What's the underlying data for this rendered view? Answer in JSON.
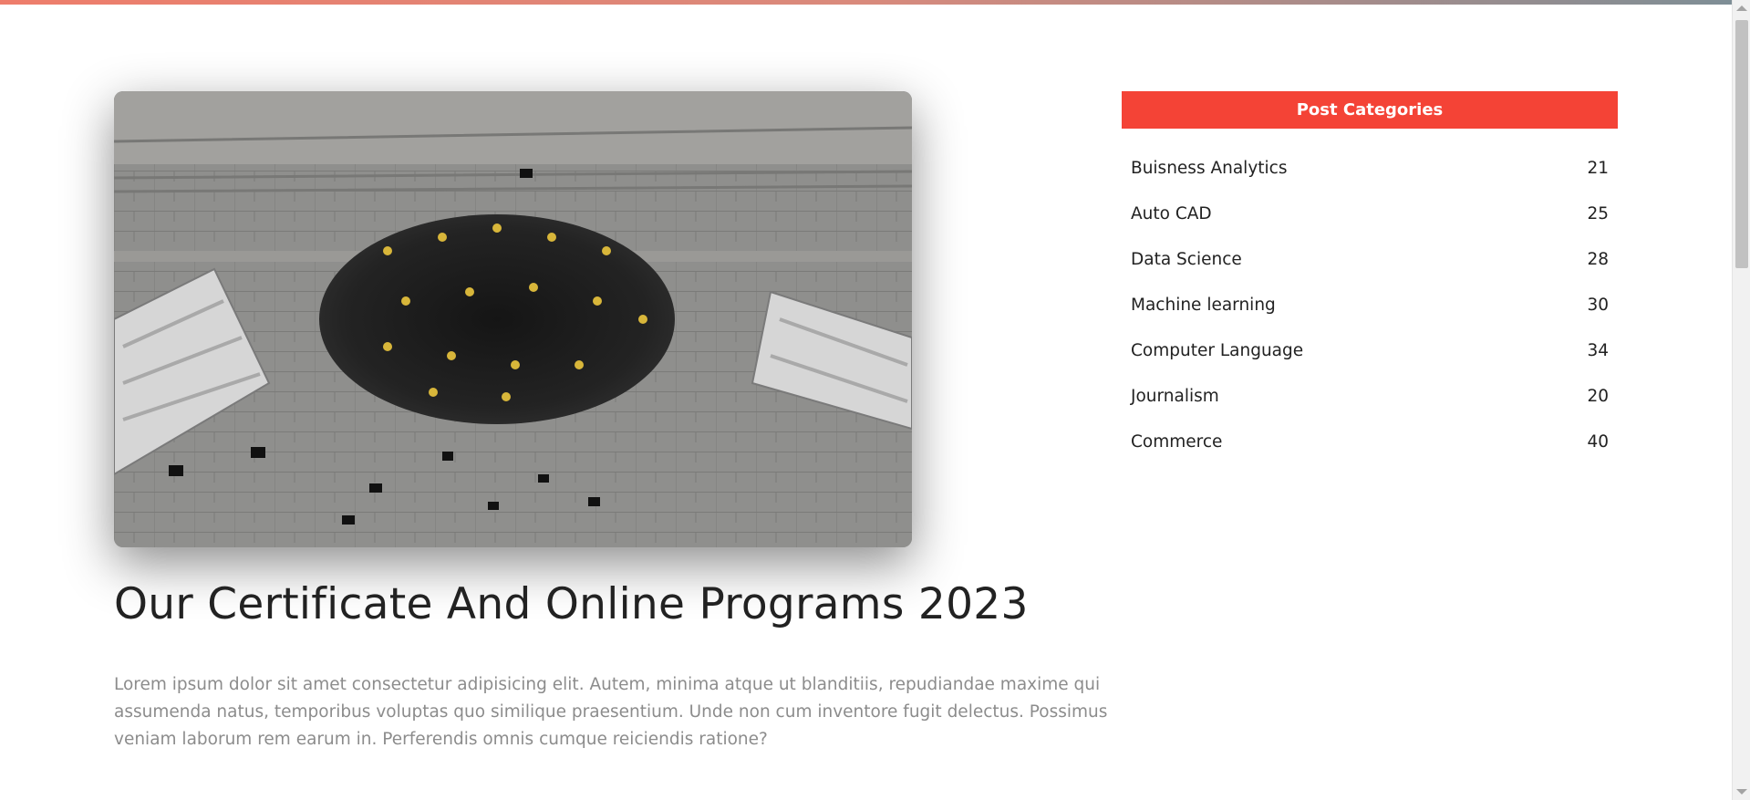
{
  "post": {
    "title": "Our Certificate And Online Programs 2023",
    "body": "Lorem ipsum dolor sit amet consectetur adipisicing elit. Autem, minima atque ut blanditiis, repudiandae maxime qui assumenda natus, temporibus voluptas quo similique praesentium. Unde non cum inventore fugit delectus. Possimus veniam laborum rem earum in. Perferendis omnis cumque reiciendis ratione?"
  },
  "sidebar": {
    "title": "Post Categories",
    "categories": [
      {
        "label": "Buisness Analytics",
        "count": "21"
      },
      {
        "label": "Auto CAD",
        "count": "25"
      },
      {
        "label": "Data Science",
        "count": "28"
      },
      {
        "label": "Machine learning",
        "count": "30"
      },
      {
        "label": "Computer Language",
        "count": "34"
      },
      {
        "label": "Journalism",
        "count": "20"
      },
      {
        "label": "Commerce",
        "count": "40"
      }
    ]
  },
  "colors": {
    "accent": "#f44336",
    "title_text": "#222222",
    "body_text": "#8c8c8c"
  }
}
